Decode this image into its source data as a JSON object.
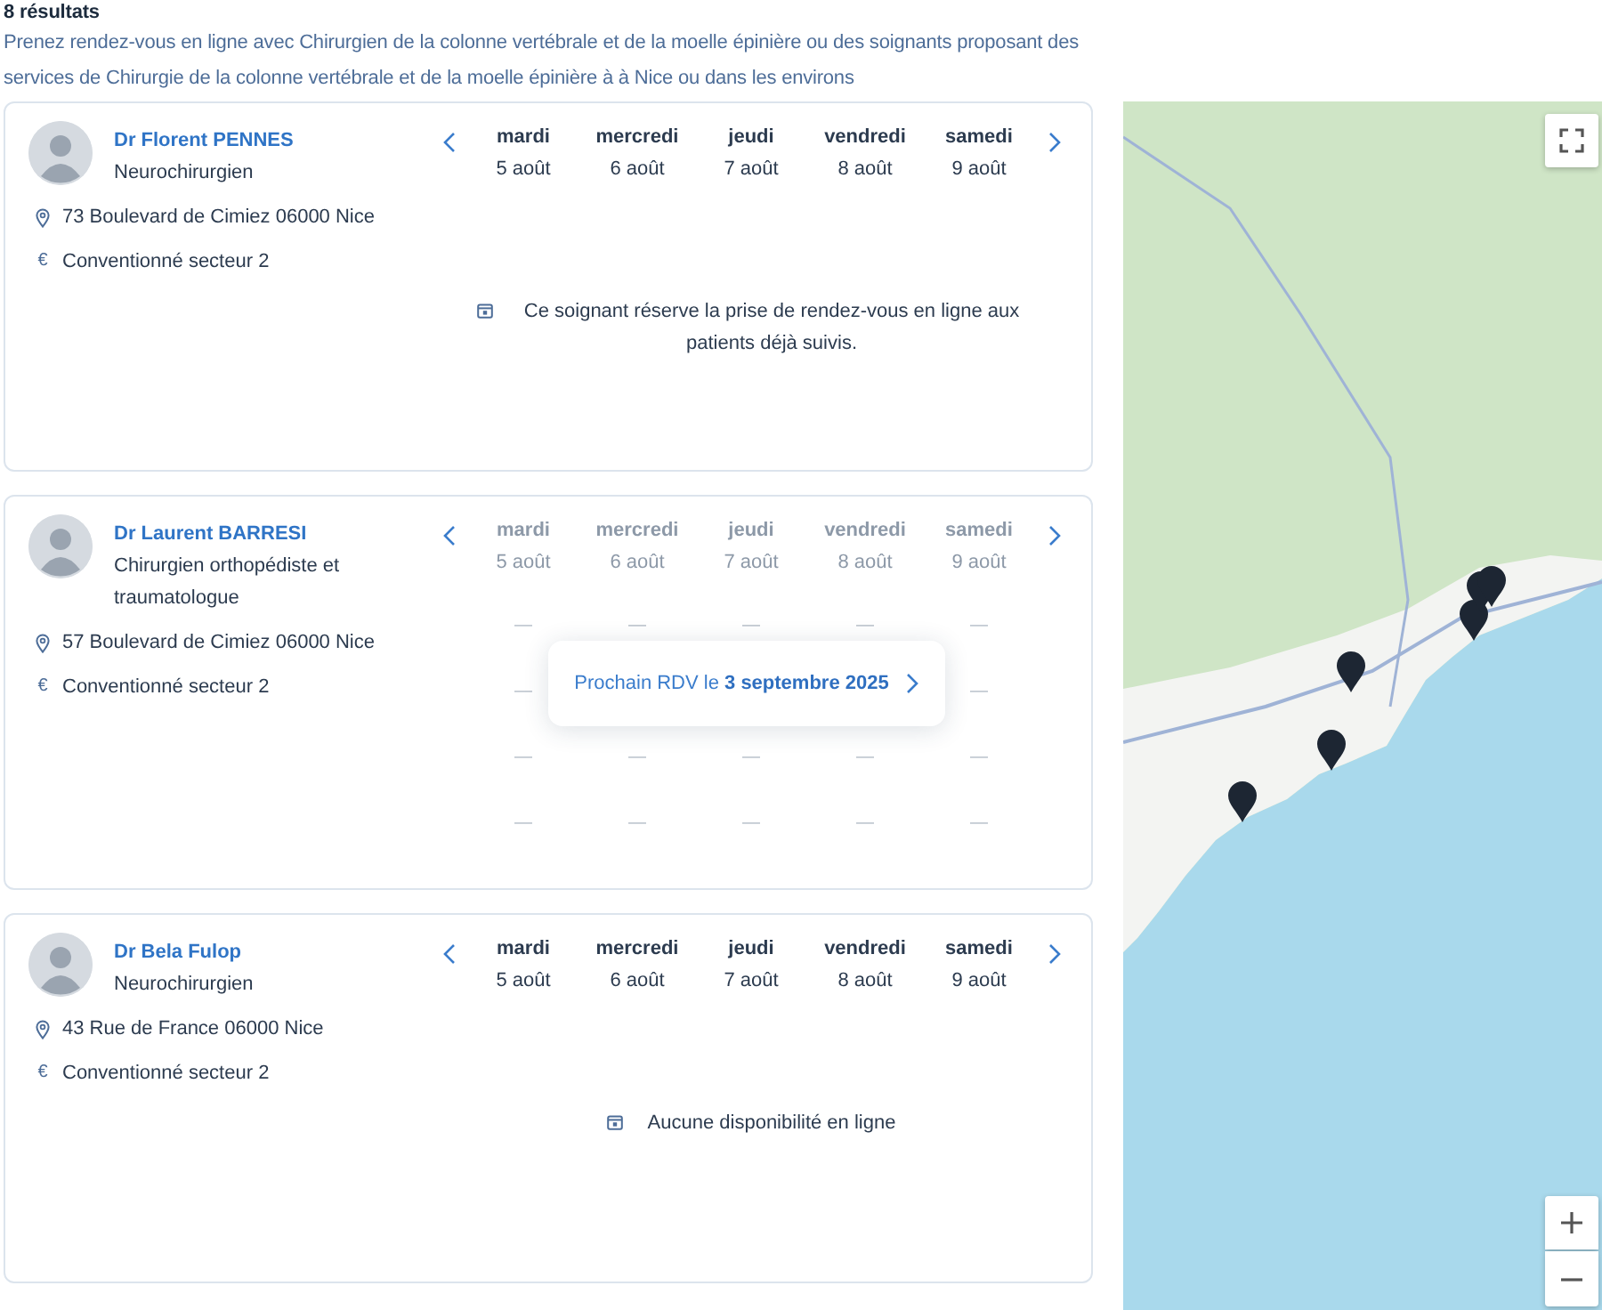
{
  "results_count": "8 résultats",
  "description": "Prenez rendez-vous en ligne avec Chirurgien de la colonne vertébrale et de la moelle épinière ou des soignants proposant des services de Chirurgie de la colonne vertébrale et de la moelle épinière à à Nice ou dans les environs",
  "doctors": [
    {
      "name": "Dr Florent PENNES",
      "specialty": "Neurochirurgien",
      "details": [
        {
          "kind": "address",
          "text": "73 Boulevard de Cimiez 06000 Nice"
        },
        {
          "kind": "fee",
          "symbol": "€",
          "text": "Conventionné secteur 2"
        }
      ],
      "days": [
        {
          "day": "mardi",
          "date": "5 août",
          "disabled": false
        },
        {
          "day": "mercredi",
          "date": "6 août",
          "disabled": false
        },
        {
          "day": "jeudi",
          "date": "7 août",
          "disabled": false
        },
        {
          "day": "vendredi",
          "date": "8 août",
          "disabled": false
        },
        {
          "day": "samedi",
          "date": "9 août",
          "disabled": false
        }
      ],
      "availability": {
        "kind": "message",
        "text": "Ce soignant réserve la prise de rendez-vous en ligne aux patients déjà suivis."
      }
    },
    {
      "name": "Dr Laurent BARRESI",
      "specialty": "Chirurgien orthopédiste et traumatologue",
      "details": [
        {
          "kind": "address",
          "text": "57 Boulevard de Cimiez 06000 Nice"
        },
        {
          "kind": "fee",
          "symbol": "€",
          "text": "Conventionné secteur 2"
        }
      ],
      "days": [
        {
          "day": "mardi",
          "date": "5 août",
          "disabled": true
        },
        {
          "day": "mercredi",
          "date": "6 août",
          "disabled": true
        },
        {
          "day": "jeudi",
          "date": "7 août",
          "disabled": true
        },
        {
          "day": "vendredi",
          "date": "8 août",
          "disabled": true
        },
        {
          "day": "samedi",
          "date": "9 août",
          "disabled": true
        }
      ],
      "availability": {
        "kind": "next_slot",
        "slots": [
          [
            "—",
            "—",
            "—",
            "—",
            "—"
          ],
          [
            "—",
            "—"
          ],
          [
            "—",
            "—",
            "—",
            "—",
            "—"
          ],
          [
            "—",
            "—",
            "—",
            "—",
            "—"
          ]
        ],
        "label": "Prochain RDV le **3 septembre 2025**"
      }
    },
    {
      "name": "Dr Bela Fulop",
      "specialty": "Neurochirurgien",
      "details": [
        {
          "kind": "address",
          "text": "43 Rue de France 06000 Nice"
        },
        {
          "kind": "fee",
          "symbol": "€",
          "text": "Conventionné secteur 2"
        }
      ],
      "days": [
        {
          "day": "mardi",
          "date": "5 août",
          "disabled": false
        },
        {
          "day": "mercredi",
          "date": "6 août",
          "disabled": false
        },
        {
          "day": "jeudi",
          "date": "7 août",
          "disabled": false
        },
        {
          "day": "vendredi",
          "date": "8 août",
          "disabled": false
        },
        {
          "day": "samedi",
          "date": "9 août",
          "disabled": false
        }
      ],
      "availability": {
        "kind": "message",
        "text": "Aucune disponibilité en ligne"
      }
    }
  ]
}
